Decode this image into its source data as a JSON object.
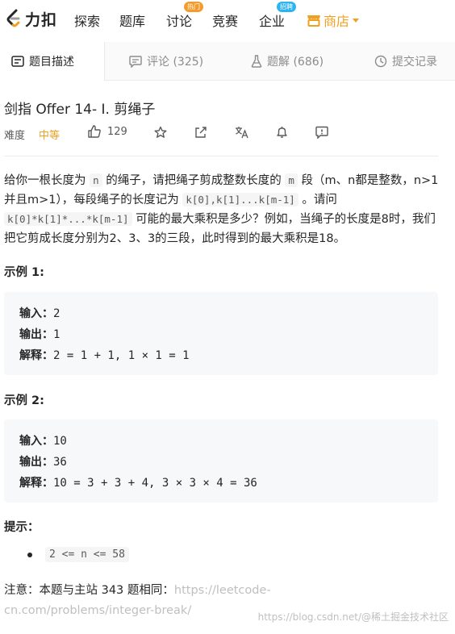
{
  "nav": {
    "logo_text": "力扣",
    "items": [
      {
        "label": "探索"
      },
      {
        "label": "题库"
      },
      {
        "label": "讨论",
        "badge": "热门",
        "badge_color": "#f39c2d"
      },
      {
        "label": "竞赛"
      },
      {
        "label": "企业",
        "badge": "招聘",
        "badge_color": "#2db3f0"
      }
    ],
    "store_label": "商店",
    "store_color": "#f0a020"
  },
  "tabs": [
    {
      "label": "题目描述",
      "icon": "doc-icon",
      "active": true
    },
    {
      "label": "评论 (325)",
      "icon": "comment-icon"
    },
    {
      "label": "题解 (686)",
      "icon": "flask-icon"
    },
    {
      "label": "提交记录",
      "icon": "clock-icon"
    }
  ],
  "problem": {
    "title": "剑指 Offer 14- I. 剪绳子",
    "difficulty_label": "难度",
    "difficulty": "中等",
    "difficulty_color": "#f0a020",
    "likes": "129",
    "desc": {
      "p1": "给你一根长度为 ",
      "c_n": "n",
      "p2": " 的绳子，请把绳子剪成整数长度的 ",
      "c_m": "m",
      "p3": " 段（m、n都是整数，n>1并且m>1），每段绳子的长度记为 ",
      "c_k": "k[0],k[1]...k[m-1]",
      "p4": " 。请问 ",
      "c_prod": "k[0]*k[1]*...*k[m-1]",
      "p5": " 可能的最大乘积是多少？例如，当绳子的长度是8时，我们把它剪成长度分别为2、3、3的三段，此时得到的最大乘积是18。"
    },
    "examples": [
      {
        "title": "示例 1:",
        "input_label": "输入：",
        "input": "2",
        "output_label": "输出：",
        "output": "1",
        "explain_label": "解释：",
        "explain": "2 = 1 + 1, 1 × 1 = 1"
      },
      {
        "title": "示例 2:",
        "input_label": "输入：",
        "input": "10",
        "output_label": "输出：",
        "output": "36",
        "explain_label": "解释：",
        "explain": "10 = 3 + 3 + 4, 3 × 3 × 4 = 36"
      }
    ],
    "tips_title": "提示：",
    "tips": [
      "2 <= n <= 58"
    ],
    "note_prefix": "注意：本题与主站 343 题相同：",
    "note_link": "https://leetcode-cn.com/problems/integer-break/"
  },
  "watermark": "https://blog.csdn.net/@稀土掘金技术社区"
}
